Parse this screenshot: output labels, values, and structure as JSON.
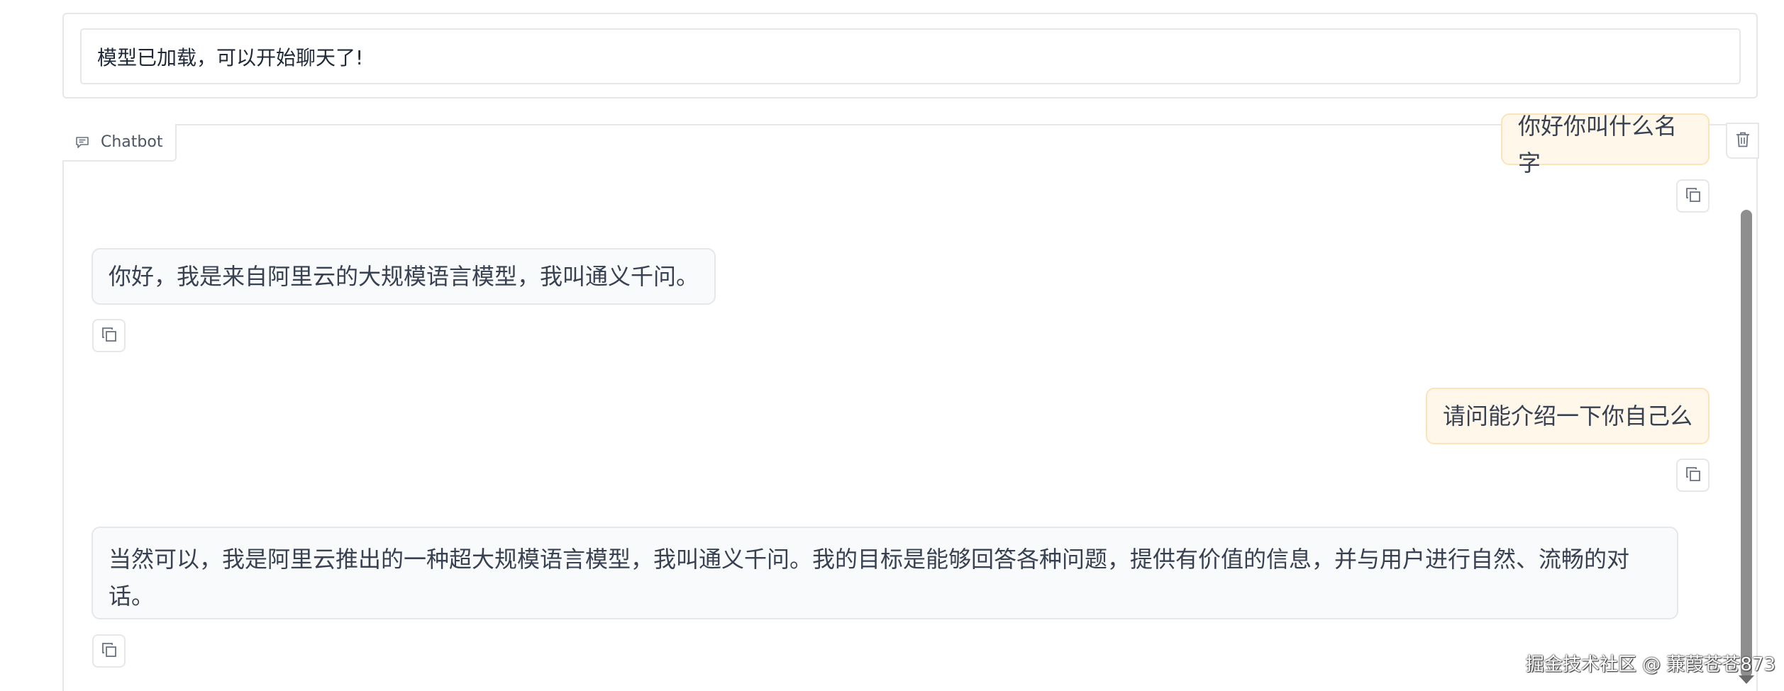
{
  "status": {
    "text": "模型已加载，可以开始聊天了!"
  },
  "chatbot": {
    "label": "Chatbot",
    "messages": [
      {
        "role": "user",
        "text": "你好你叫什么名字"
      },
      {
        "role": "bot",
        "text": "你好，我是来自阿里云的大规模语言模型，我叫通义千问。"
      },
      {
        "role": "user",
        "text": "请问能介绍一下你自己么"
      },
      {
        "role": "bot",
        "text": "当然可以，我是阿里云推出的一种超大规模语言模型，我叫通义千问。我的目标是能够回答各种问题，提供有价值的信息，并与用户进行自然、流畅的对话。"
      }
    ]
  },
  "icons": {
    "label_icon": "chat-bubble-icon",
    "copy": "copy-icon",
    "clear": "trash-icon"
  },
  "watermark": "掘金技术社区 @ 蒹葭苍苍873"
}
